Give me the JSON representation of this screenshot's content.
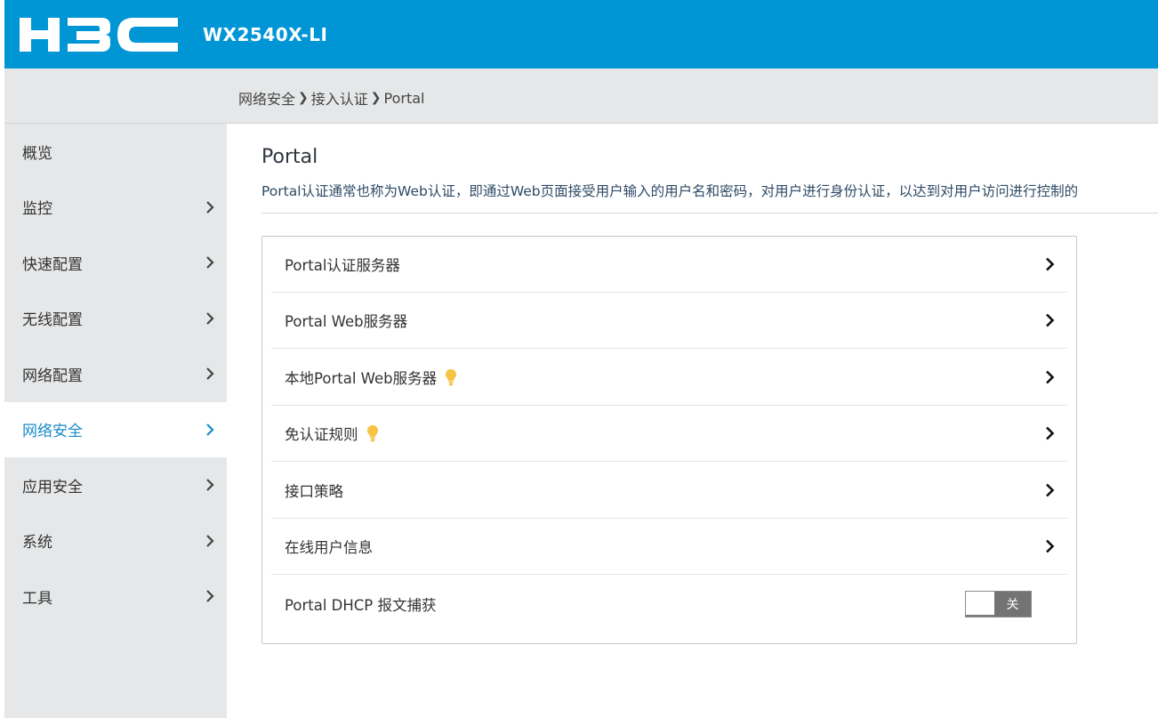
{
  "header": {
    "brand": "H3C",
    "model": "WX2540X-LI",
    "brand_color": "#0096d6"
  },
  "breadcrumb": [
    "网络安全",
    "接入认证",
    "Portal"
  ],
  "sidebar": {
    "items": [
      {
        "label": "概览",
        "has_arrow": false,
        "active": false
      },
      {
        "label": "监控",
        "has_arrow": true,
        "active": false
      },
      {
        "label": "快速配置",
        "has_arrow": true,
        "active": false
      },
      {
        "label": "无线配置",
        "has_arrow": true,
        "active": false
      },
      {
        "label": "网络配置",
        "has_arrow": true,
        "active": false
      },
      {
        "label": "网络安全",
        "has_arrow": true,
        "active": true
      },
      {
        "label": "应用安全",
        "has_arrow": true,
        "active": false
      },
      {
        "label": "系统",
        "has_arrow": true,
        "active": false
      },
      {
        "label": "工具",
        "has_arrow": true,
        "active": false
      }
    ],
    "active_color": "#1a8bc8"
  },
  "page": {
    "title": "Portal",
    "description": "Portal认证通常也称为Web认证，即通过Web页面接受用户输入的用户名和密码，对用户进行身份认证，以达到对用户访问进行控制的"
  },
  "rows": [
    {
      "label": "Portal认证服务器",
      "bulb": false
    },
    {
      "label": "Portal Web服务器",
      "bulb": false
    },
    {
      "label": "本地Portal Web服务器",
      "bulb": true
    },
    {
      "label": "免认证规则",
      "bulb": true
    },
    {
      "label": "接口策略",
      "bulb": false
    },
    {
      "label": "在线用户信息",
      "bulb": false
    }
  ],
  "dhcp_row": {
    "label": "Portal DHCP 报文捕获",
    "toggle_label": "关",
    "toggle_on": false
  },
  "bulb_color": "#f6c343"
}
